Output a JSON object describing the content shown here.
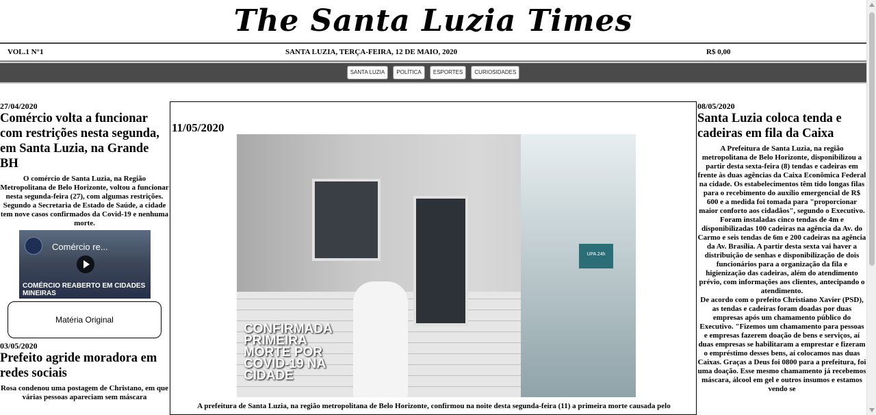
{
  "masthead": {
    "title": "The Santa Luzia Times"
  },
  "info": {
    "volume": "VOL.1 N°1",
    "dateline": "SANTA LUZIA, TERÇA-FEIRA, 12 DE MAIO, 2020",
    "price": "R$ 0,00"
  },
  "nav": {
    "items": [
      "SANTA LUZIA",
      "POLÍTICA",
      "ESPORTES",
      "CURIOSIDADES"
    ]
  },
  "left": {
    "article1": {
      "date": "27/04/2020",
      "headline": "Comércio volta a funcionar com restrições nesta segunda, em Santa Luzia, na Grande BH",
      "p1": "O comércio de Santa Luzia, na Região Metropolitana de Belo Horizonte, voltou a funcionar nesta segunda-feira (27), com algumas restrições.",
      "p2": "Segundo a Secretaria de Estado de Saúde, a cidade tem nove casos confirmados da Covid-19 e nenhuma morte.",
      "video_title": "Comércio re...",
      "video_caption": "COMÉRCIO REABERTO EM CIDADES MINEIRAS",
      "button": "Matéria Original"
    },
    "article2": {
      "date": "03/05/2020",
      "headline": "Prefeito agride moradora em redes sociais",
      "p1": "Rosa condenou uma postagem de Christano, em que várias pessoas apareciam sem máscara"
    }
  },
  "center": {
    "date": "11/05/2020",
    "image_overlay": "CONFIRMADA PRIMEIRA MORTE POR COVID-19 NA CIDADE",
    "image_sign": "UPA 24h",
    "article": "A prefeitura de Santa Luzia, na região metropolitana de Belo Horizonte, confirmou na noite desta segunda-feira (11) a primeira morte causada pelo"
  },
  "right": {
    "date": "08/05/2020",
    "headline": "Santa Luzia coloca tenda e cadeiras em fila da Caixa",
    "p1": "A Prefeitura de Santa Luzia, na região metropolitana de Belo Horizonte, disponibilizou a partir desta sexta-feira (8) tendas e cadeiras em frente às duas agências da Caixa Econômica Federal na cidade. Os estabelecimentos têm tido longas filas para o recebimento do auxílio emergencial de R$ 600 e a medida foi tomada para \"proporcionar maior conforto aos cidadãos\", segundo o Executivo.",
    "p2": "Foram instaladas cinco tendas de 4m e disponibilizadas 100 cadeiras na agência da Av. do Carmo e seis tendas de 6m e 200 cadeiras na agência da Av. Brasília. A partir desta sexta vai haver a distribuição de senhas e disponibilização de dois funcionários para a organização da fila e higienização das cadeiras, além do atendimento prévio, com informações aos clientes, antecipando o atendimento.",
    "p3": "De acordo com o prefeito Christiano Xavier (PSD), as tendas e cadeiras foram doadas por duas empresas após um chamamento público do Executivo. \"Fizemos um chamamento para pessoas e empresas fazerem doação de bens e serviços, aí duas empresas se habilitaram a emprestar e fizeram o empréstimo desses bens, aí colocamos nas duas Caixas. Graças a Deus foi 0800 para a prefeitura, foi uma doação. Esse mesmo chamamento já recebemos máscara, álcool em gel e outros insumos e estamos vendo se"
  }
}
